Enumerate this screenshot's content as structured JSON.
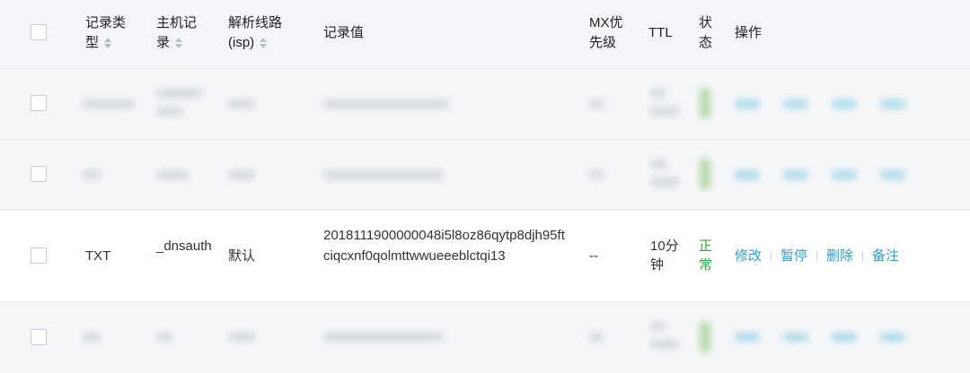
{
  "header": {
    "record_type": "记录类型",
    "host_record": "主机记录",
    "line": "解析线路(isp)",
    "record_value": "记录值",
    "mx_priority": "MX优先级",
    "ttl": "TTL",
    "status": "状态",
    "actions": "操作"
  },
  "visible_row": {
    "type": "TXT",
    "host": "_dnsauth",
    "line": "默认",
    "value": "2018111900000048i5l8oz86qytp8djh95ftciqcxnf0qolmttwwueeeblctqi13",
    "mx": "--",
    "ttl": "10分钟",
    "status": "正常",
    "actions": [
      "修改",
      "暂停",
      "删除",
      "备注"
    ]
  },
  "colors": {
    "header_bg": "#f3f5f8",
    "row_blur_bg": "#f5f6f8",
    "status_green": "#3aa63a",
    "action_blue": "#2f9fd1"
  }
}
